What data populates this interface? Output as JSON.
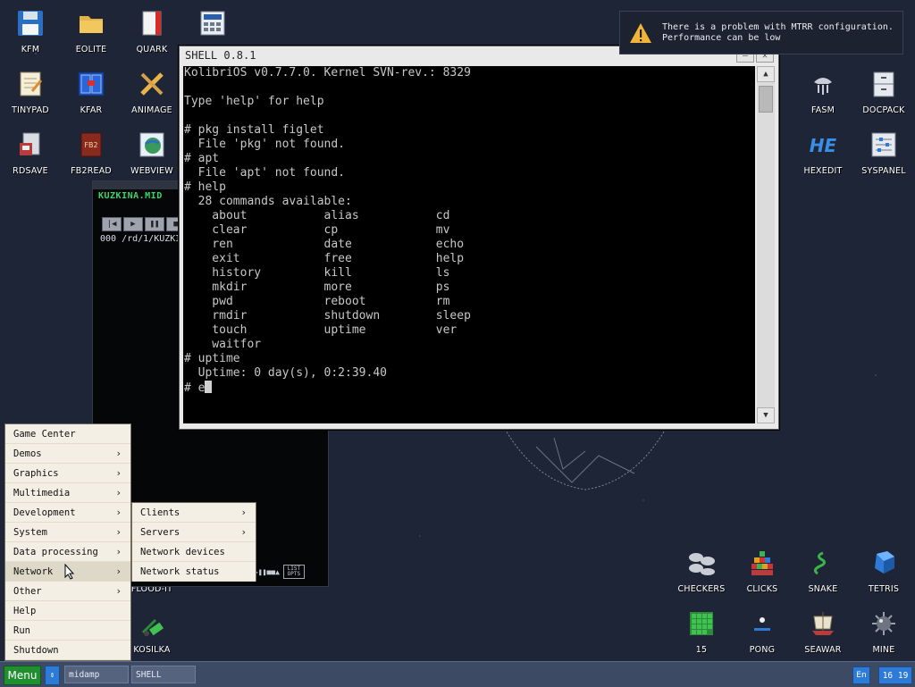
{
  "desktop_icons": [
    {
      "id": "kfm",
      "label": "KFM",
      "icon": "floppy-icon"
    },
    {
      "id": "eolite",
      "label": "EOLITE",
      "icon": "folder-icon"
    },
    {
      "id": "quark",
      "label": "QUARK",
      "icon": "book-icon"
    },
    {
      "id": "calc",
      "label": "",
      "icon": "calculator-icon"
    },
    {
      "id": "tinypad",
      "label": "TINYPAD",
      "icon": "notepad-icon"
    },
    {
      "id": "kfar",
      "label": "KFAR",
      "icon": "file-manager-icon"
    },
    {
      "id": "animage",
      "label": "ANIMAGE",
      "icon": "pencil-icon"
    },
    {
      "id": "rdsave",
      "label": "RDSAVE",
      "icon": "disk-save-icon"
    },
    {
      "id": "fb2read",
      "label": "FB2READ",
      "icon": "ebook-icon"
    },
    {
      "id": "webview",
      "label": "WEBVIEW",
      "icon": "globe-icon"
    },
    {
      "id": "fasm",
      "label": "FASM",
      "icon": "chip-icon"
    },
    {
      "id": "docpack",
      "label": "DOCPACK",
      "icon": "cabinet-icon"
    },
    {
      "id": "hexedit",
      "label": "HEXEDIT",
      "icon": "hex-icon"
    },
    {
      "id": "syspanel",
      "label": "SYSPANEL",
      "icon": "sliders-icon"
    },
    {
      "id": "checkers",
      "label": "CHECKERS",
      "icon": "checkers-icon"
    },
    {
      "id": "clicks",
      "label": "CLICKS",
      "icon": "blocks-icon"
    },
    {
      "id": "snake",
      "label": "SNAKE",
      "icon": "snake-icon"
    },
    {
      "id": "tetris",
      "label": "TETRIS",
      "icon": "tetris-icon"
    },
    {
      "id": "fifteen",
      "label": "15",
      "icon": "grid-icon"
    },
    {
      "id": "pong",
      "label": "PONG",
      "icon": "pong-icon"
    },
    {
      "id": "seawar",
      "label": "SEAWAR",
      "icon": "ship-icon"
    },
    {
      "id": "mine",
      "label": "MINE",
      "icon": "mine-icon"
    },
    {
      "id": "kosilka",
      "label": "KOSILKA",
      "icon": "mower-icon"
    },
    {
      "id": "flood",
      "label": "FLOOD-IT",
      "icon": "flood-icon"
    }
  ],
  "notification": {
    "line1": "There is a problem with MTRR configuration.",
    "line2": "Performance can be low"
  },
  "midamp": {
    "song": "KUZKINA.MID",
    "track": "000 /rd/1/KUZKI",
    "list_label_1": "LIST",
    "list_label_2": "OPTS"
  },
  "shell": {
    "title": "SHELL 0.8.1",
    "lines": [
      "KolibriOS v0.7.7.0. Kernel SVN-rev.: 8329",
      "",
      "Type 'help' for help",
      "",
      "# pkg install figlet",
      "  File 'pkg' not found.",
      "# apt",
      "  File 'apt' not found.",
      "# help",
      "  28 commands available:",
      "    about           alias           cd",
      "    clear           cp              mv",
      "    ren             date            echo",
      "    exit            free            help",
      "    history         kill            ls",
      "    mkdir           more            ps",
      "    pwd             reboot          rm",
      "    rmdir           shutdown        sleep",
      "    touch           uptime          ver",
      "    waitfor",
      "# uptime",
      "  Uptime: 0 day(s), 0:2:39.40"
    ],
    "prompt": "# e"
  },
  "main_menu": [
    {
      "label": "Game Center",
      "sub": false
    },
    {
      "label": "Demos",
      "sub": true
    },
    {
      "label": "Graphics",
      "sub": true
    },
    {
      "label": "Multimedia",
      "sub": true
    },
    {
      "label": "Development",
      "sub": true
    },
    {
      "label": "System",
      "sub": true
    },
    {
      "label": "Data processing",
      "sub": true
    },
    {
      "label": "Network",
      "sub": true
    },
    {
      "label": "Other",
      "sub": true
    },
    {
      "label": "Help",
      "sub": false
    },
    {
      "label": "Run",
      "sub": false
    },
    {
      "label": "Shutdown",
      "sub": false
    }
  ],
  "sub_menu": [
    {
      "label": "Clients",
      "sub": true
    },
    {
      "label": "Servers",
      "sub": true
    },
    {
      "label": "Network devices",
      "sub": false
    },
    {
      "label": "Network status",
      "sub": false
    }
  ],
  "taskbar": {
    "menu_label": "Menu",
    "tasks": [
      "midamp",
      "SHELL"
    ],
    "lang": "En",
    "clock": "16 19"
  },
  "colors": {
    "desktop_bg": "#1e2536",
    "taskbar_bg": "#3d4a63",
    "menu_button": "#1f8f2f",
    "accent_blue": "#2d7bd6",
    "midamp_song": "#3bd46a"
  }
}
